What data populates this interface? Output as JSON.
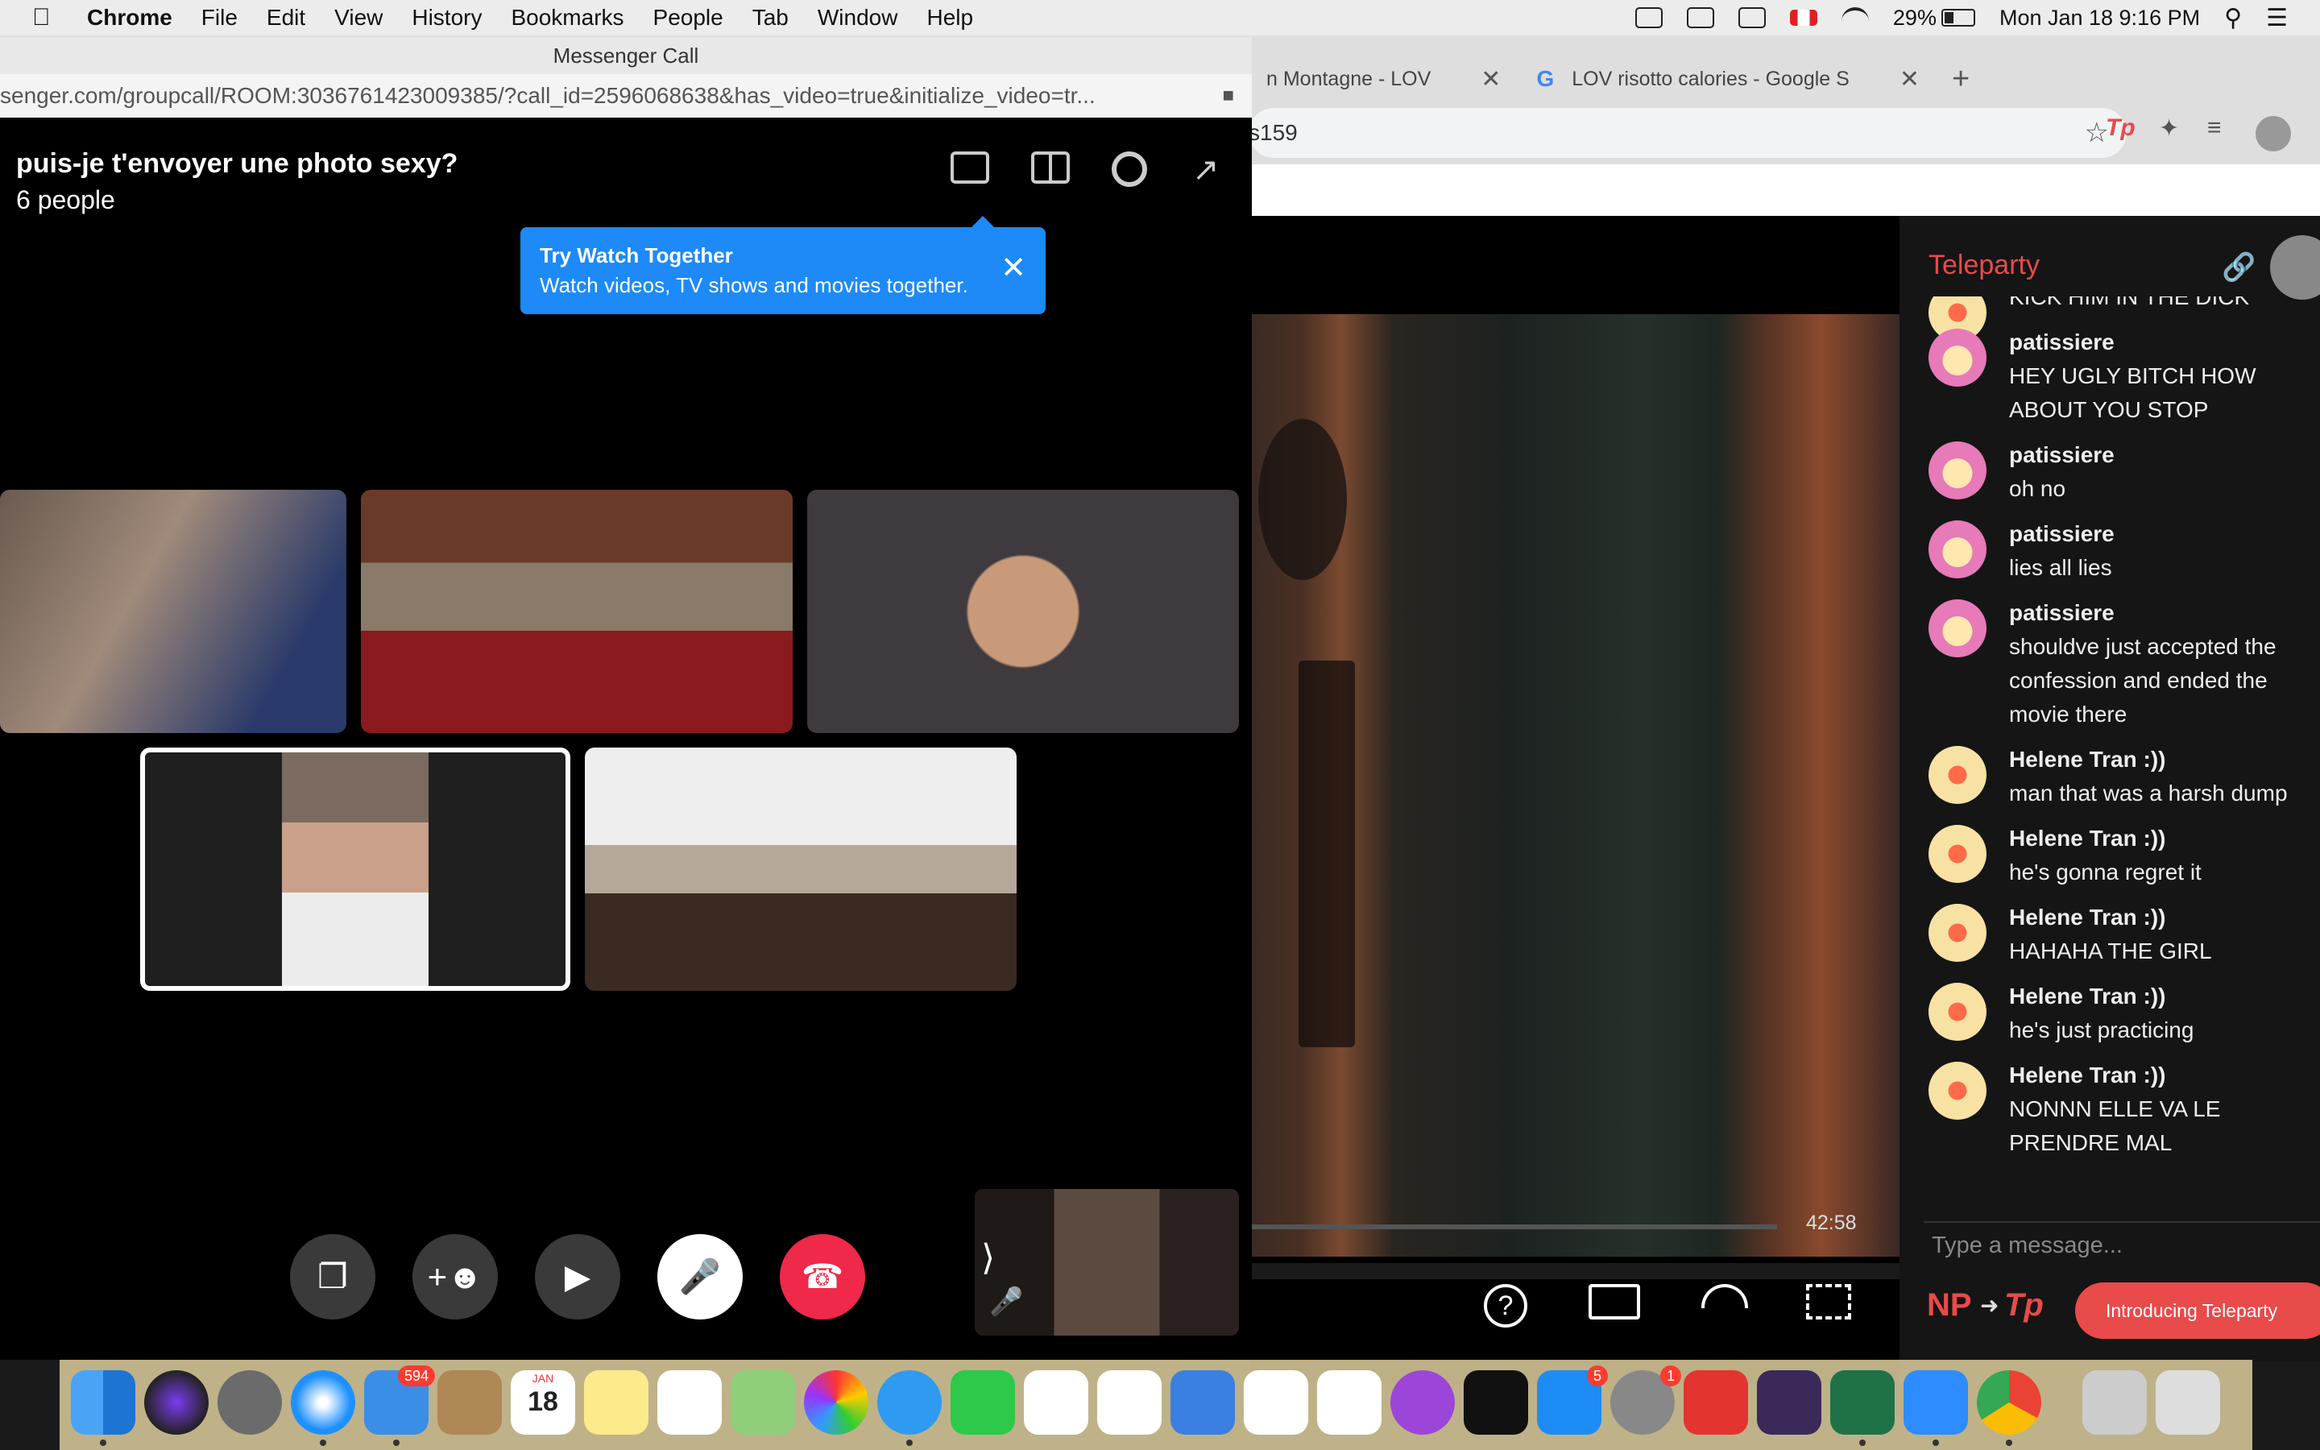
{
  "menubar": {
    "app_name": "Chrome",
    "items": [
      "File",
      "Edit",
      "View",
      "History",
      "Bookmarks",
      "People",
      "Tab",
      "Window",
      "Help"
    ],
    "battery": "29%",
    "datetime": "Mon Jan 18  9:16 PM"
  },
  "chrome": {
    "tab1_title": "n Montagne - LOV",
    "tab2_title": "LOV risotto calories - Google S",
    "tab2_favicon": "G",
    "url_fragment": "s159"
  },
  "player": {
    "time_remaining": "42:58",
    "progress_fraction": 0.0
  },
  "teleparty": {
    "title": "Teleparty",
    "input_placeholder": "Type a message...",
    "np_label": "NP",
    "tp_label": "Tp",
    "intro_button": "Introducing Teleparty",
    "messages": [
      {
        "name": "",
        "text": "KICK HIM IN THE DICK",
        "avatar": "yellow"
      },
      {
        "name": "patissiere",
        "text": "HEY UGLY BITCH HOW ABOUT YOU STOP",
        "avatar": "pink"
      },
      {
        "name": "patissiere",
        "text": "oh no",
        "avatar": "pink"
      },
      {
        "name": "patissiere",
        "text": "lies all lies",
        "avatar": "pink"
      },
      {
        "name": "patissiere",
        "text": "shouldve just accepted the confession and ended the movie there",
        "avatar": "pink"
      },
      {
        "name": "Helene Tran :))",
        "text": "man that was a harsh dump",
        "avatar": "yellow"
      },
      {
        "name": "Helene Tran :))",
        "text": "he's gonna regret it",
        "avatar": "yellow"
      },
      {
        "name": "Helene Tran :))",
        "text": "HAHAHA THE GIRL",
        "avatar": "yellow"
      },
      {
        "name": "Helene Tran :))",
        "text": "he's just practicing",
        "avatar": "yellow"
      },
      {
        "name": "Helene Tran :))",
        "text": "NONNN ELLE VA LE PRENDRE MAL",
        "avatar": "yellow"
      }
    ]
  },
  "messenger": {
    "window_title": "Messenger Call",
    "url": "senger.com/groupcall/ROOM:3036761423009385/?call_id=2596068638&has_video=true&initialize_video=tr...",
    "call_title": "puis-je t'envoyer une photo sexy?",
    "participants": "6 people",
    "tooltip_title": "Try Watch Together",
    "tooltip_body": "Watch videos, TV shows and movies together."
  },
  "dock": {
    "mail_badge": "594",
    "calendar_month": "JAN",
    "calendar_day": "18",
    "appstore_badge": "5",
    "prefs_badge": "1"
  },
  "colors": {
    "teleparty_red": "#e94a4a",
    "messenger_blue": "#1d8af7",
    "end_call_red": "#f02849"
  }
}
